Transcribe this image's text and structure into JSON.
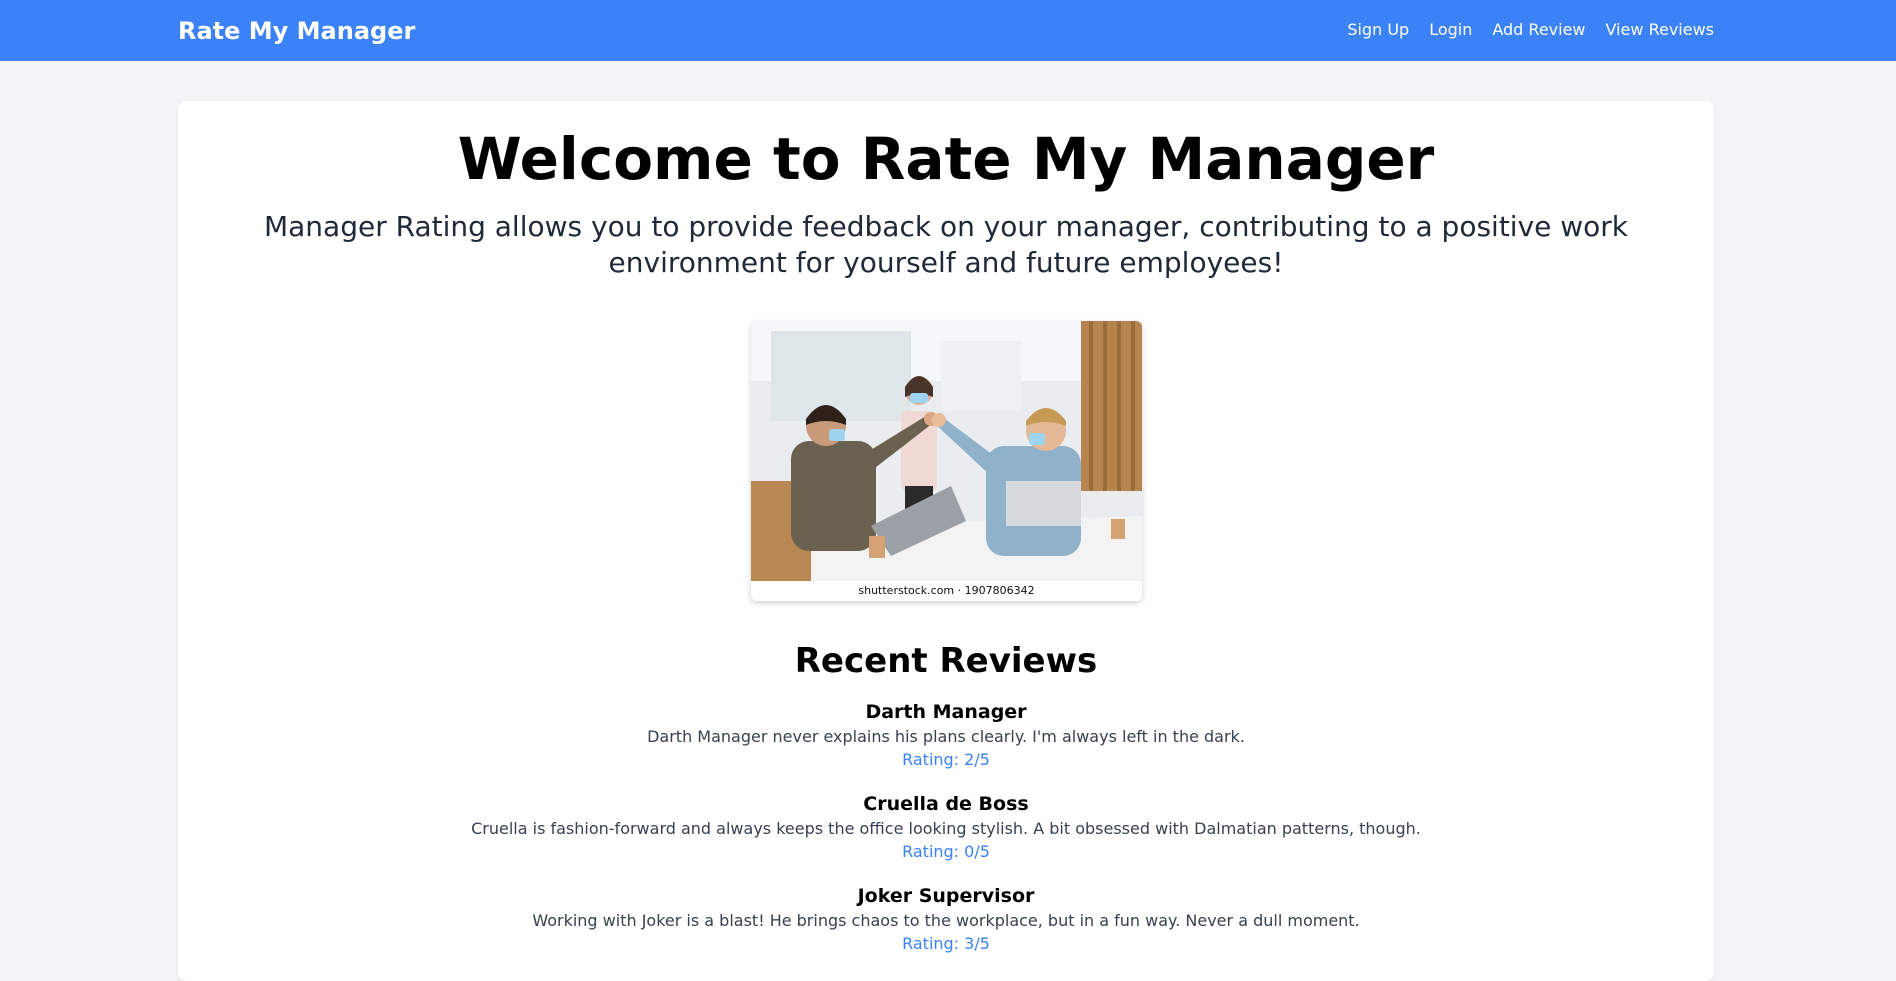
{
  "header": {
    "brand": "Rate My Manager",
    "nav": [
      "Sign Up",
      "Login",
      "Add Review",
      "View Reviews"
    ]
  },
  "hero": {
    "title": "Welcome to Rate My Manager",
    "subtitle": "Manager Rating allows you to provide feedback on your manager, contributing to a positive work environment for yourself and future employees!"
  },
  "image": {
    "caption": "shutterstock.com · 1907806342"
  },
  "reviews": {
    "heading": "Recent Reviews",
    "items": [
      {
        "name": "Darth Manager",
        "text": "Darth Manager never explains his plans clearly. I'm always left in the dark.",
        "rating": "Rating: 2/5"
      },
      {
        "name": "Cruella de Boss",
        "text": "Cruella is fashion-forward and always keeps the office looking stylish. A bit obsessed with Dalmatian patterns, though.",
        "rating": "Rating: 0/5"
      },
      {
        "name": "Joker Supervisor",
        "text": "Working with Joker is a blast! He brings chaos to the workplace, but in a fun way. Never a dull moment.",
        "rating": "Rating: 3/5"
      }
    ]
  },
  "colors": {
    "accent": "#3b82f6",
    "background": "#f3f4f6",
    "card": "#ffffff"
  }
}
